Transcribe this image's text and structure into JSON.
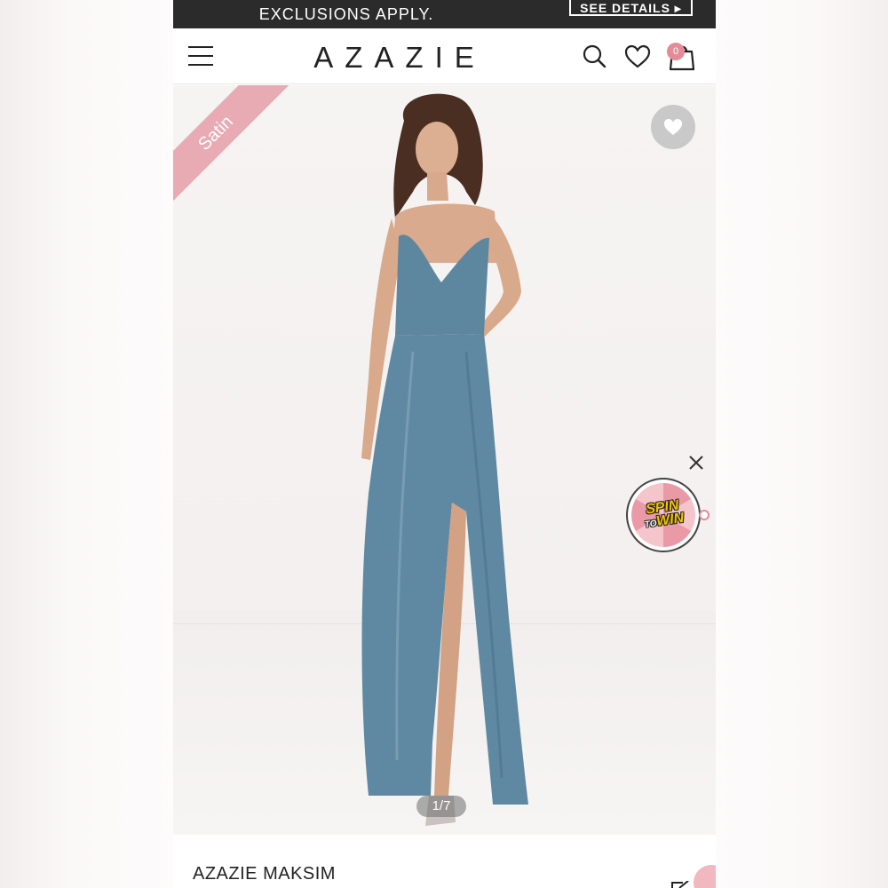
{
  "promo": {
    "text": "EXCLUSIONS APPLY.",
    "button_label": "SEE DETAILS ▸"
  },
  "header": {
    "logo": "AZAZIE",
    "cart_count": "0",
    "icons": [
      "menu-icon",
      "search-icon",
      "heart-icon",
      "shopping-bag-icon"
    ]
  },
  "product_image": {
    "ribbon_label": "Satin",
    "counter": "1/7",
    "dress_color": "#5f89a2"
  },
  "spin_widget": {
    "line1": "SPIN",
    "line2": "TO",
    "line3": "WIN"
  },
  "product": {
    "title": "AZAZIE MAKSIM"
  },
  "colors": {
    "accent_pink": "#e8aab3",
    "banner_dark": "#2b2b2b"
  }
}
